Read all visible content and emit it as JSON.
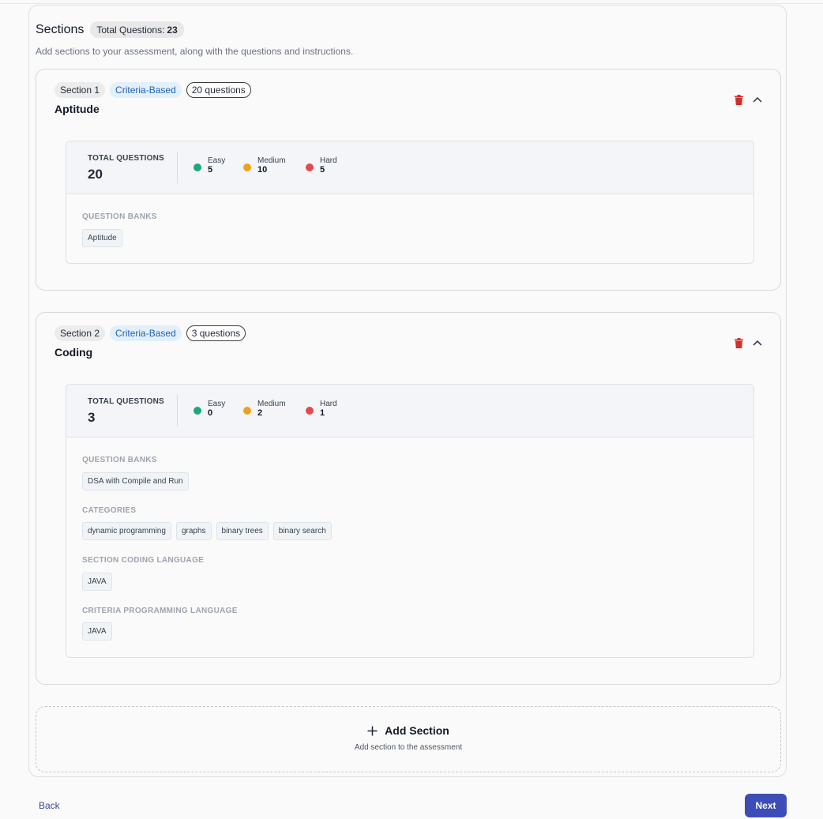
{
  "header": {
    "title": "Sections",
    "total_label": "Total Questions:",
    "total_value": "23",
    "subtitle": "Add sections to your assessment, along with the questions and instructions."
  },
  "sections": [
    {
      "badge": "Section 1",
      "type": "Criteria-Based",
      "count": "20 questions",
      "title": "Aptitude",
      "total_label": "TOTAL QUESTIONS",
      "total": "20",
      "easy_label": "Easy",
      "easy": "5",
      "medium_label": "Medium",
      "medium": "10",
      "hard_label": "Hard",
      "hard": "5",
      "banks_label": "QUESTION BANKS",
      "banks": [
        "Aptitude"
      ]
    },
    {
      "badge": "Section 2",
      "type": "Criteria-Based",
      "count": "3 questions",
      "title": "Coding",
      "total_label": "TOTAL QUESTIONS",
      "total": "3",
      "easy_label": "Easy",
      "easy": "0",
      "medium_label": "Medium",
      "medium": "2",
      "hard_label": "Hard",
      "hard": "1",
      "banks_label": "QUESTION BANKS",
      "banks": [
        "DSA with Compile and Run"
      ],
      "categories_label": "CATEGORIES",
      "categories": [
        "dynamic programming",
        "graphs",
        "binary trees",
        "binary search"
      ],
      "coding_lang_label": "SECTION CODING LANGUAGE",
      "coding_lang": [
        "JAVA"
      ],
      "criteria_lang_label": "CRITERIA PROGRAMMING LANGUAGE",
      "criteria_lang": [
        "JAVA"
      ]
    }
  ],
  "add_section": {
    "title": "Add Section",
    "subtitle": "Add section to the assessment"
  },
  "footer": {
    "back": "Back",
    "next": "Next"
  },
  "colors": {
    "easy": "#1aaa7a",
    "medium": "#f0a11c",
    "hard": "#e5484d",
    "delete": "#d32f2f",
    "primary": "#3d4db7"
  },
  "icons": {
    "delete": "trash-icon",
    "collapse": "chevron-up-icon",
    "add": "plus-icon"
  }
}
